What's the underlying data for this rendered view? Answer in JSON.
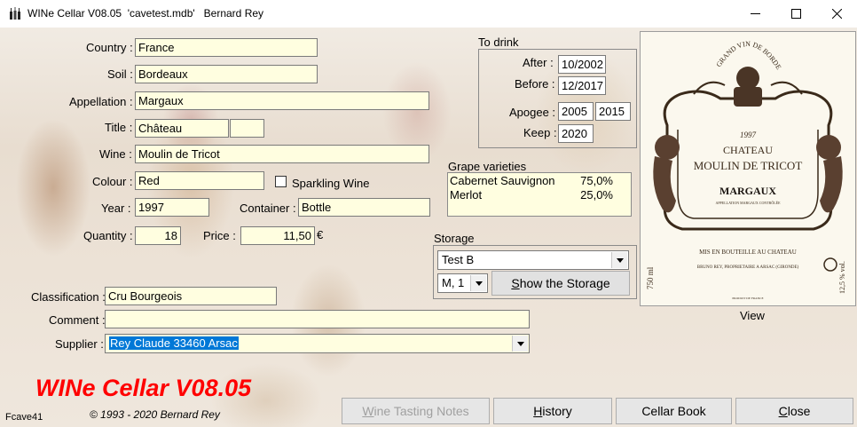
{
  "window": {
    "title": "WINe Cellar V08.05  'cavetest.mdb'   Bernard Rey",
    "icons": {
      "app": "wine-bottles-icon",
      "minimize": "minimize-icon",
      "maximize": "maximize-icon",
      "close": "close-icon"
    }
  },
  "form": {
    "country": {
      "label": "Country :",
      "value": "France"
    },
    "soil": {
      "label": "Soil :",
      "value": "Bordeaux"
    },
    "appellation": {
      "label": "Appellation :",
      "value": "Margaux"
    },
    "title": {
      "label": "Title :",
      "value": "Château",
      "value2": ""
    },
    "wine": {
      "label": "Wine :",
      "value": "Moulin de Tricot"
    },
    "colour": {
      "label": "Colour :",
      "value": "Red"
    },
    "sparkling": {
      "label": "Sparkling Wine",
      "checked": false
    },
    "year": {
      "label": "Year :",
      "value": "1997"
    },
    "container": {
      "label": "Container :",
      "value": "Bottle"
    },
    "quantity": {
      "label": "Quantity :",
      "value": "18"
    },
    "price": {
      "label": "Price :",
      "value": "11,50",
      "currency": "€"
    },
    "classification": {
      "label": "Classification :",
      "value": "Cru Bourgeois"
    },
    "comment": {
      "label": "Comment :",
      "value": ""
    },
    "supplier": {
      "label": "Supplier :",
      "value": "Rey Claude 33460 Arsac"
    }
  },
  "to_drink": {
    "title": "To drink",
    "after": {
      "label": "After :",
      "value": "10/2002"
    },
    "before": {
      "label": "Before :",
      "value": "12/2017"
    },
    "apogee": {
      "label": "Apogee :",
      "from": "2005",
      "to": "2015"
    },
    "keep": {
      "label": "Keep :",
      "value": "2020"
    }
  },
  "grapes": {
    "title": "Grape varieties",
    "items": [
      {
        "name": "Cabernet Sauvignon",
        "pct": "75,0%"
      },
      {
        "name": "Merlot",
        "pct": "25,0%"
      }
    ]
  },
  "storage": {
    "title": "Storage",
    "location": "Test B",
    "position": "M, 1",
    "show_button": "Show the Storage"
  },
  "label_image": {
    "caption": "View",
    "top_arc": "GRAND VIN DE BORDEAUX",
    "vintage": "1997",
    "chateau": "CHATEAU",
    "name": "MOULIN DE TRICOT",
    "appellation": "MARGAUX",
    "appellation_note": "APPELLATION MARGAUX CONTRÔLÉE",
    "bottled": "MIS EN BOUTEILLE AU CHATEAU",
    "owner": "BRUNO REY, PROPRIETAIRE A ARSAC (GIRONDE)",
    "volume": "750 ml",
    "alcohol": "12,5 % vol.",
    "origin": "PRODUIT DE FRANCE"
  },
  "footer": {
    "brand": "WINe Cellar V08.05",
    "copyright": "© 1993 - 2020 Bernard Rey",
    "form_id": "Fcave41",
    "buttons": {
      "tasting": "Wine Tasting Notes",
      "history": "History",
      "cellar_book": "Cellar Book",
      "close": "Close"
    }
  },
  "colors": {
    "field_bg": "#fffee0",
    "brand_red": "#ff0000",
    "selection": "#0078d7"
  }
}
